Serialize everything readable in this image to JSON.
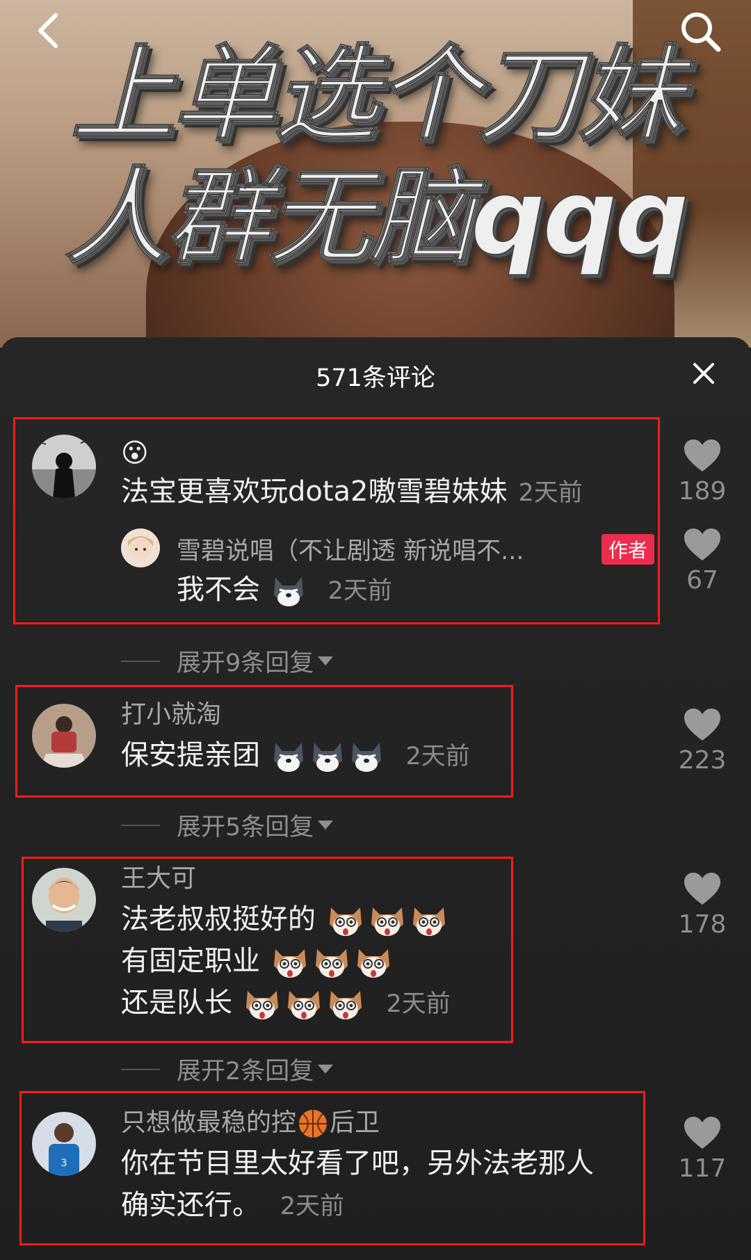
{
  "video": {
    "caption_line1": "上单选个刀妹",
    "caption_line2": "人群无脑qqq"
  },
  "sheet": {
    "title": "571条评论"
  },
  "comments": [
    {
      "emoji_line": "😮",
      "text": "法宝更喜欢玩dota2嗷雪碧妹妹",
      "time": "2天前",
      "likes": "189",
      "reply": {
        "username": "雪碧说唱（不让剧透 新说唱不...",
        "badge": "作者",
        "text": "我不会",
        "time": "2天前",
        "likes": "67"
      },
      "expand": "展开9条回复"
    },
    {
      "username": "打小就淘",
      "text": "保安提亲团",
      "time": "2天前",
      "likes": "223",
      "expand": "展开5条回复"
    },
    {
      "username": "王大可",
      "lines": [
        "法老叔叔挺好的",
        "有固定职业",
        "还是队长"
      ],
      "time": "2天前",
      "likes": "178",
      "expand": "展开2条回复"
    },
    {
      "username_a": "只想做最稳的控",
      "username_b": "后卫",
      "lines": [
        "你在节目里太好看了吧，另外法老那人",
        "确实还行。"
      ],
      "time": "2天前",
      "likes": "117"
    }
  ],
  "icons": [
    "back-arrow-icon",
    "search-icon",
    "close-icon",
    "heart-icon",
    "husky-emoji",
    "dog-emoji",
    "basketball-icon"
  ],
  "colors": {
    "highlight_box": "#ff1a1a",
    "author_badge": "#ee2c4e",
    "like_gray": "#8e8e8e"
  }
}
